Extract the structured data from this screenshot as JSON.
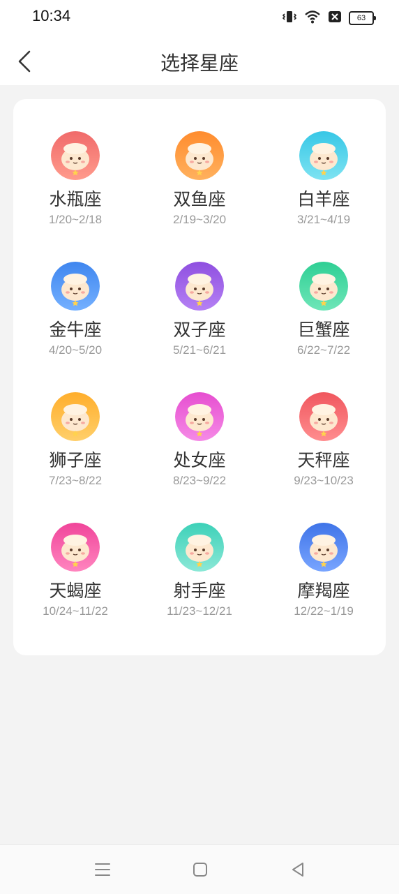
{
  "status_bar": {
    "time": "10:34",
    "battery": "63",
    "icons": [
      "vibrate-icon",
      "wifi-icon",
      "no-sim-icon",
      "battery-icon"
    ]
  },
  "header": {
    "title": "选择星座",
    "back_icon": "chevron-left-icon"
  },
  "zodiacs": [
    {
      "name": "水瓶座",
      "dates": "1/20~2/18",
      "color": "#f06a6a",
      "color2": "#ff9b8c"
    },
    {
      "name": "双鱼座",
      "dates": "2/19~3/20",
      "color": "#ff8c2e",
      "color2": "#ffb15e"
    },
    {
      "name": "白羊座",
      "dates": "3/21~4/19",
      "color": "#37c7e6",
      "color2": "#7ee3f2"
    },
    {
      "name": "金牛座",
      "dates": "4/20~5/20",
      "color": "#3f86ef",
      "color2": "#74b0ff"
    },
    {
      "name": "双子座",
      "dates": "5/21~6/21",
      "color": "#8f4fe0",
      "color2": "#b581f4"
    },
    {
      "name": "巨蟹座",
      "dates": "6/22~7/22",
      "color": "#2fcf94",
      "color2": "#6ee6b8"
    },
    {
      "name": "狮子座",
      "dates": "7/23~8/22",
      "color": "#ffae2c",
      "color2": "#ffcf6a"
    },
    {
      "name": "处女座",
      "dates": "8/23~9/22",
      "color": "#e64ed0",
      "color2": "#f58ae6"
    },
    {
      "name": "天秤座",
      "dates": "9/23~10/23",
      "color": "#f0575e",
      "color2": "#ff8d8f"
    },
    {
      "name": "天蝎座",
      "dates": "10/24~11/22",
      "color": "#f0459a",
      "color2": "#ff85bf"
    },
    {
      "name": "射手座",
      "dates": "11/23~12/21",
      "color": "#3dd1b8",
      "color2": "#8be8d7"
    },
    {
      "name": "摩羯座",
      "dates": "12/22~1/19",
      "color": "#3f74e8",
      "color2": "#79a5ff"
    }
  ],
  "nav_bar": {
    "menu_icon": "menu-icon",
    "home_icon": "home-square-icon",
    "back_icon": "back-triangle-icon"
  }
}
